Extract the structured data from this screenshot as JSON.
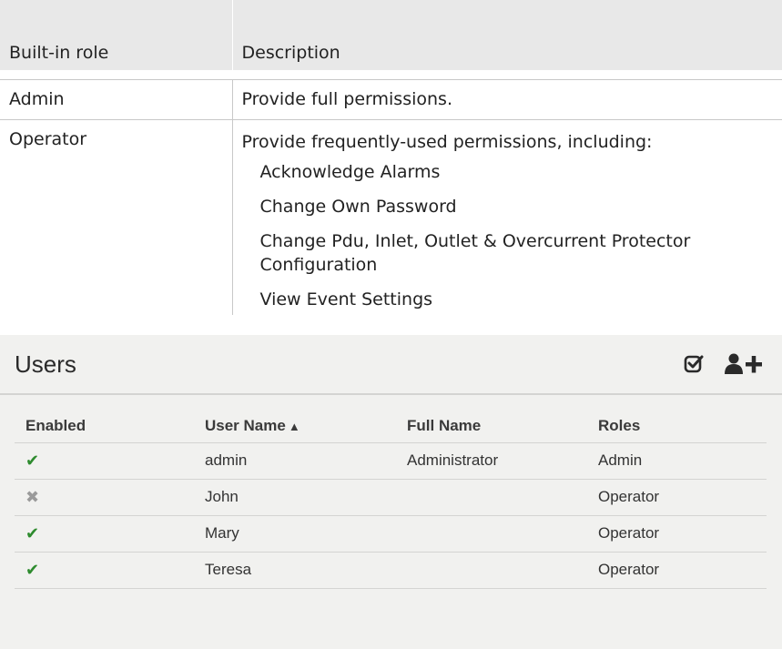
{
  "roles_table": {
    "headers": {
      "role": "Built-in role",
      "description": "Description"
    },
    "admin": {
      "role": "Admin",
      "description": "Provide full permissions."
    },
    "operator": {
      "role": "Operator",
      "description": "Provide frequently-used permissions, including:",
      "permissions": [
        "Acknowledge Alarms",
        "Change Own Password",
        "Change Pdu, Inlet, Outlet & Overcurrent Protector Configuration",
        "View Event Settings"
      ]
    }
  },
  "users_panel": {
    "title": "Users",
    "icons": {
      "select": "checkbox-edit-icon",
      "add_user": "add-user-icon"
    },
    "columns": {
      "enabled": "Enabled",
      "user_name": "User Name",
      "sort_indicator": "▲",
      "full_name": "Full Name",
      "roles": "Roles"
    },
    "rows": [
      {
        "enabled": "✔",
        "user_name": "admin",
        "full_name": "Administrator",
        "roles": "Admin"
      },
      {
        "enabled": "✖",
        "user_name": "John",
        "full_name": "",
        "roles": "Operator"
      },
      {
        "enabled": "✔",
        "user_name": "Mary",
        "full_name": "",
        "roles": "Operator"
      },
      {
        "enabled": "✔",
        "user_name": "Teresa",
        "full_name": "",
        "roles": "Operator"
      }
    ],
    "colors": {
      "enabled_check": "#2e8b2e",
      "disabled_cross": "#9a9a9a",
      "panel_background": "#f1f1ef"
    }
  }
}
